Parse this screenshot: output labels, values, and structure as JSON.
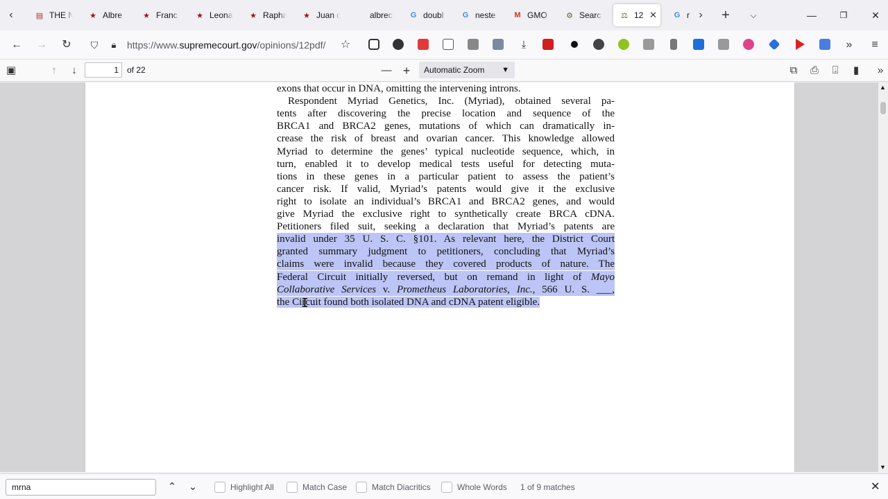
{
  "tabs": [
    {
      "title": "THE N",
      "fav": "▤",
      "color": "#b03030"
    },
    {
      "title": "Albre",
      "fav": "★",
      "color": "#a01020"
    },
    {
      "title": "Franc",
      "fav": "★",
      "color": "#a01020"
    },
    {
      "title": "Leona",
      "fav": "★",
      "color": "#a01020"
    },
    {
      "title": "Rapha",
      "fav": "★",
      "color": "#a01020"
    },
    {
      "title": "Juan d",
      "fav": "★",
      "color": "#a01020"
    },
    {
      "title": "albrecht-d",
      "fav": "",
      "color": "#333333"
    },
    {
      "title": "doubl",
      "fav": "G",
      "color": "#4285f4"
    },
    {
      "title": "neste",
      "fav": "G",
      "color": "#4285f4"
    },
    {
      "title": "GMO",
      "fav": "M",
      "color": "#d93025"
    },
    {
      "title": "Searc",
      "fav": "⚙",
      "color": "#556b2f"
    },
    {
      "title": "12",
      "fav": "⚖",
      "color": "#556b2f",
      "active": true
    },
    {
      "title": "r",
      "fav": "G",
      "color": "#4285f4"
    }
  ],
  "tab_close": "✕",
  "url": {
    "prefix": "https://www.",
    "domain": "supremecourt.gov",
    "path": "/opinions/12pdf/"
  },
  "pdf": {
    "page": "1",
    "count": "of 22",
    "zoom": "Automatic Zoom"
  },
  "doc": {
    "lines": [
      {
        "text": "exons that occur in DNA, omitting the intervening introns.",
        "last": true
      },
      {
        "text": "Respondent Myriad Genetics, Inc. (Myriad), obtained several pa-",
        "indent": true
      },
      {
        "text": "tents after discovering the precise location and sequence of the"
      },
      {
        "text": "BRCA1 and BRCA2 genes, mutations of which can dramatically in-"
      },
      {
        "text": "crease the risk of breast and ovarian cancer.  This knowledge allowed"
      },
      {
        "text": "Myriad to determine the genes’ typical nucleotide sequence, which, in"
      },
      {
        "text": "turn, enabled it to develop medical tests useful for detecting muta-"
      },
      {
        "text": "tions in these genes in a particular patient to assess the patient’s"
      },
      {
        "text": "cancer risk.  If valid, Myriad’s patents would give it the exclusive"
      },
      {
        "text": "right to isolate an individual’s BRCA1 and BRCA2 genes, and would"
      },
      {
        "text": "give Myriad the exclusive right to synthetically create BRCA cDNA."
      },
      {
        "text": "Petitioners filed suit, seeking a declaration that Myriad’s patents are"
      },
      {
        "pre": "invalid under 35 U. S. C. §101.  ",
        "hl": "As relevant here, the District Court"
      },
      {
        "hl": "granted summary judgment to petitioners, concluding that Myriad’s"
      },
      {
        "hl": "claims were invalid because they covered products of nature.  The"
      },
      {
        "hl": "Federal Circuit initially reversed, but on remand in light of Mayo"
      },
      {
        "hl_italic": [
          "Collaborative Services",
          " v. ",
          "Prometheus Laboratories, Inc.",
          ", 566 U. S. ___,"
        ]
      },
      {
        "hl": "the Circuit found both isolated DNA and cDNA patent eligible.",
        "last": true
      }
    ]
  },
  "find": {
    "query": "mrna",
    "highlight_all": "Highlight All",
    "match_case": "Match Case",
    "match_diacritics": "Match Diacritics",
    "whole_words": "Whole Words",
    "status": "1 of 9 matches"
  }
}
